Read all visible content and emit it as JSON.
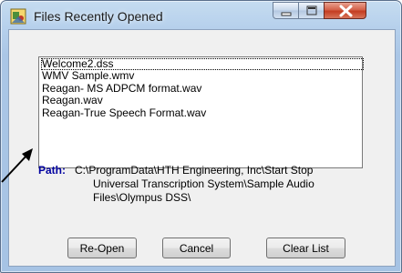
{
  "window": {
    "title": "Files Recently Opened"
  },
  "recent_files": [
    "Welcome2.dss",
    "WMV Sample.wmv",
    "Reagan- MS ADPCM format.wav",
    "Reagan.wav",
    "Reagan-True Speech Format.wav"
  ],
  "path": {
    "label": "Path:",
    "line1": "C:\\ProgramData\\HTH Engineering, Inc\\Start Stop",
    "line2": "Universal Transcription System\\Sample Audio",
    "line3": "Files\\Olympus DSS\\"
  },
  "buttons": {
    "reopen": "Re-Open",
    "cancel": "Cancel",
    "clear_list": "Clear List"
  },
  "icons": {
    "app": "transcription-app-icon",
    "minimize": "minimize-icon",
    "maximize": "maximize-icon",
    "close": "close-icon",
    "annotation": "arrow-icon"
  },
  "colors": {
    "path_label": "#0000a0",
    "title_bar": "#b6d0ec",
    "close_button": "#c43d22"
  }
}
